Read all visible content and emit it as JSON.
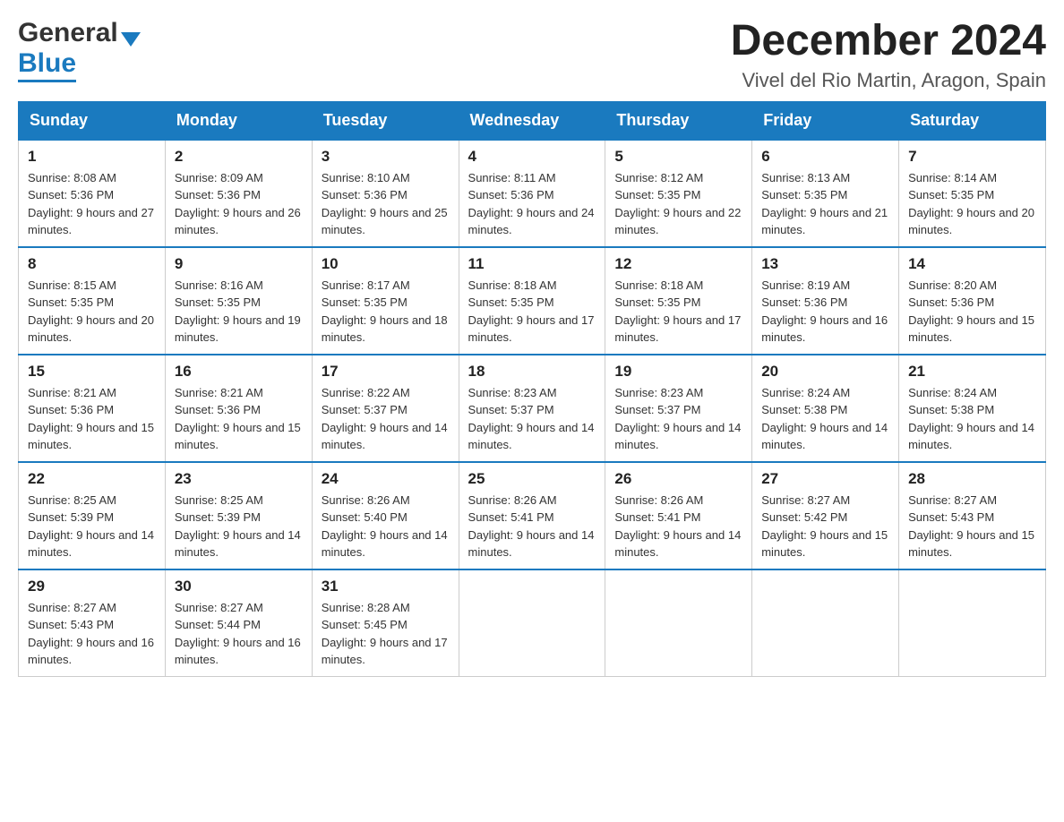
{
  "header": {
    "month_year": "December 2024",
    "location": "Vivel del Rio Martin, Aragon, Spain",
    "logo_general": "General",
    "logo_blue": "Blue"
  },
  "days_of_week": [
    "Sunday",
    "Monday",
    "Tuesday",
    "Wednesday",
    "Thursday",
    "Friday",
    "Saturday"
  ],
  "weeks": [
    [
      {
        "day": "1",
        "sunrise": "8:08 AM",
        "sunset": "5:36 PM",
        "daylight": "9 hours and 27 minutes."
      },
      {
        "day": "2",
        "sunrise": "8:09 AM",
        "sunset": "5:36 PM",
        "daylight": "9 hours and 26 minutes."
      },
      {
        "day": "3",
        "sunrise": "8:10 AM",
        "sunset": "5:36 PM",
        "daylight": "9 hours and 25 minutes."
      },
      {
        "day": "4",
        "sunrise": "8:11 AM",
        "sunset": "5:36 PM",
        "daylight": "9 hours and 24 minutes."
      },
      {
        "day": "5",
        "sunrise": "8:12 AM",
        "sunset": "5:35 PM",
        "daylight": "9 hours and 22 minutes."
      },
      {
        "day": "6",
        "sunrise": "8:13 AM",
        "sunset": "5:35 PM",
        "daylight": "9 hours and 21 minutes."
      },
      {
        "day": "7",
        "sunrise": "8:14 AM",
        "sunset": "5:35 PM",
        "daylight": "9 hours and 20 minutes."
      }
    ],
    [
      {
        "day": "8",
        "sunrise": "8:15 AM",
        "sunset": "5:35 PM",
        "daylight": "9 hours and 20 minutes."
      },
      {
        "day": "9",
        "sunrise": "8:16 AM",
        "sunset": "5:35 PM",
        "daylight": "9 hours and 19 minutes."
      },
      {
        "day": "10",
        "sunrise": "8:17 AM",
        "sunset": "5:35 PM",
        "daylight": "9 hours and 18 minutes."
      },
      {
        "day": "11",
        "sunrise": "8:18 AM",
        "sunset": "5:35 PM",
        "daylight": "9 hours and 17 minutes."
      },
      {
        "day": "12",
        "sunrise": "8:18 AM",
        "sunset": "5:35 PM",
        "daylight": "9 hours and 17 minutes."
      },
      {
        "day": "13",
        "sunrise": "8:19 AM",
        "sunset": "5:36 PM",
        "daylight": "9 hours and 16 minutes."
      },
      {
        "day": "14",
        "sunrise": "8:20 AM",
        "sunset": "5:36 PM",
        "daylight": "9 hours and 15 minutes."
      }
    ],
    [
      {
        "day": "15",
        "sunrise": "8:21 AM",
        "sunset": "5:36 PM",
        "daylight": "9 hours and 15 minutes."
      },
      {
        "day": "16",
        "sunrise": "8:21 AM",
        "sunset": "5:36 PM",
        "daylight": "9 hours and 15 minutes."
      },
      {
        "day": "17",
        "sunrise": "8:22 AM",
        "sunset": "5:37 PM",
        "daylight": "9 hours and 14 minutes."
      },
      {
        "day": "18",
        "sunrise": "8:23 AM",
        "sunset": "5:37 PM",
        "daylight": "9 hours and 14 minutes."
      },
      {
        "day": "19",
        "sunrise": "8:23 AM",
        "sunset": "5:37 PM",
        "daylight": "9 hours and 14 minutes."
      },
      {
        "day": "20",
        "sunrise": "8:24 AM",
        "sunset": "5:38 PM",
        "daylight": "9 hours and 14 minutes."
      },
      {
        "day": "21",
        "sunrise": "8:24 AM",
        "sunset": "5:38 PM",
        "daylight": "9 hours and 14 minutes."
      }
    ],
    [
      {
        "day": "22",
        "sunrise": "8:25 AM",
        "sunset": "5:39 PM",
        "daylight": "9 hours and 14 minutes."
      },
      {
        "day": "23",
        "sunrise": "8:25 AM",
        "sunset": "5:39 PM",
        "daylight": "9 hours and 14 minutes."
      },
      {
        "day": "24",
        "sunrise": "8:26 AM",
        "sunset": "5:40 PM",
        "daylight": "9 hours and 14 minutes."
      },
      {
        "day": "25",
        "sunrise": "8:26 AM",
        "sunset": "5:41 PM",
        "daylight": "9 hours and 14 minutes."
      },
      {
        "day": "26",
        "sunrise": "8:26 AM",
        "sunset": "5:41 PM",
        "daylight": "9 hours and 14 minutes."
      },
      {
        "day": "27",
        "sunrise": "8:27 AM",
        "sunset": "5:42 PM",
        "daylight": "9 hours and 15 minutes."
      },
      {
        "day": "28",
        "sunrise": "8:27 AM",
        "sunset": "5:43 PM",
        "daylight": "9 hours and 15 minutes."
      }
    ],
    [
      {
        "day": "29",
        "sunrise": "8:27 AM",
        "sunset": "5:43 PM",
        "daylight": "9 hours and 16 minutes."
      },
      {
        "day": "30",
        "sunrise": "8:27 AM",
        "sunset": "5:44 PM",
        "daylight": "9 hours and 16 minutes."
      },
      {
        "day": "31",
        "sunrise": "8:28 AM",
        "sunset": "5:45 PM",
        "daylight": "9 hours and 17 minutes."
      },
      null,
      null,
      null,
      null
    ]
  ]
}
